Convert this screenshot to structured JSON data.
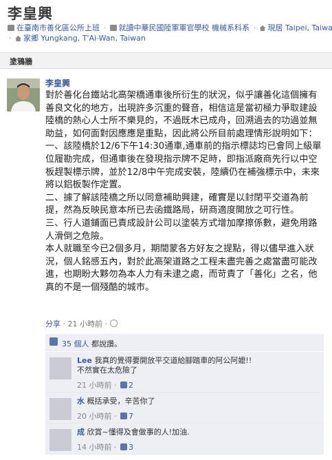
{
  "profile": {
    "name": "李皇興",
    "line1": {
      "workplace": "在臺南市善化區公所上班",
      "school": "就讀中華民國陸軍軍官學校 機械系科系",
      "current_city": "現居 Taipei, Taiwan"
    },
    "line2": {
      "hometown": "家鄉 Yungkang, T'Ai-Wan, Taiwan"
    }
  },
  "tab": {
    "label": "塗鴉牆"
  },
  "post": {
    "author": "李皇興",
    "body": "對於善化台鐵站北高架橋通車後所衍生的狀況，似乎讓善化這個擁有善良文化的地方，出現許多沉重的聲音，相信這是當初極力爭取建設陸橋的熱心人士所不樂見的，不過既木已成舟，回溯過去的功過並無助益，如何面對因應應是重點，因此將公所目前處理情形說明如下：\n一、該陸橋於12/6下午14:30通車,通車前的指示標誌均已會同上級單位履勘完成，但通車後在發現指示牌不足時，即指派廠商先行以中空板趕製標示牌，並於12/8中午完成安裝，陸續仍在補強標示中，未來將以鋁板製作定置。\n二、據了解該陸橋之所以同意補助興建，確實是以封閉平交道為前提，然為反映民意本所已去函鐵路局，研商適度開放之可行性。\n三、行人道鋪面已責成設計公司以塗裝方式增加摩擦係數，避免用路人滑倒之危險。\n本人就職至今已2個多月，期間蒙各方好友之提點，得以儘早進入狀況，個人銘感五內，對於此高架道路之工程未盡完善之處當盡可能改進，也期盼大夥勿為本人力有未逮之處，而苛責了「善化」之名，他真的不是一個殘酷的城市。",
    "share_label": "分享",
    "time": "21 小時前",
    "likes_count": "35 個人",
    "likes_suffix": "都說讚。"
  },
  "comments": [
    {
      "author": "Lee",
      "text": "我真的覺得要開放平交道給腳踏車的阿公阿嬤!!\n不然實在太危險了",
      "time": "21 小時前",
      "likes": "2"
    },
    {
      "author": "水",
      "text": "概括承受，辛苦你了",
      "time": "20 小時前",
      "likes": "7"
    },
    {
      "author": "成",
      "text": "欣賞~懂得及會做事的人!加油.",
      "time": "14 小時前",
      "likes": "3"
    }
  ],
  "colors": {
    "link": "#3b5998",
    "comment_bg": "#edeff4",
    "tab_bg": "#f2f2f2"
  }
}
